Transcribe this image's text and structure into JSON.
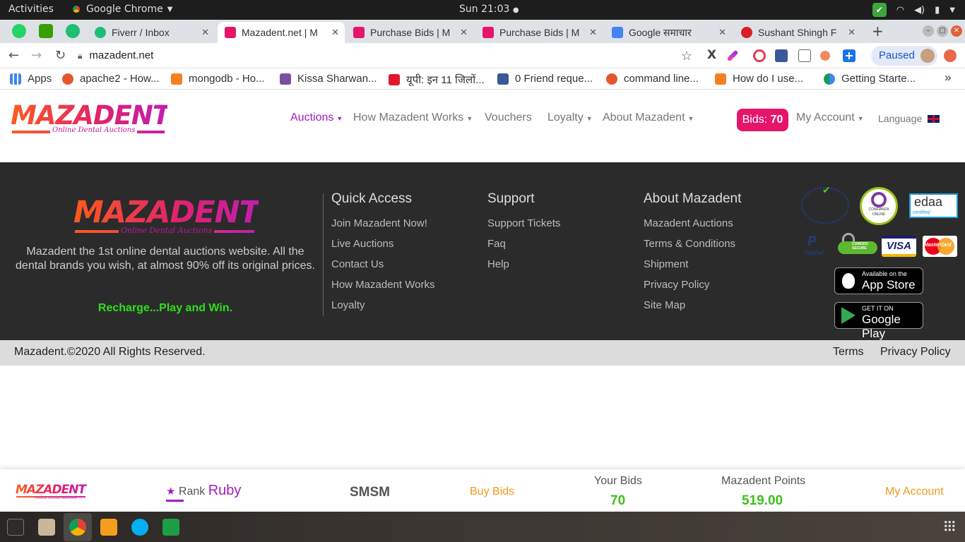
{
  "os": {
    "activities": "Activities",
    "app_name": "Google Chrome",
    "clock": "Sun 21:03"
  },
  "browser": {
    "tabs": [
      {
        "title": "Fiverr / Inbox"
      },
      {
        "title": "Mazadent.net | M"
      },
      {
        "title": "Purchase Bids | M"
      },
      {
        "title": "Purchase Bids | M"
      },
      {
        "title": "Google समाचार"
      },
      {
        "title": "Sushant Shingh F"
      }
    ],
    "url": "mazadent.net",
    "profile_status": "Paused",
    "bookmarks": [
      {
        "label": "Apps"
      },
      {
        "label": "apache2 - How..."
      },
      {
        "label": "mongodb - Ho..."
      },
      {
        "label": "Kissa Sharwan..."
      },
      {
        "label": "यूपी: इन 11 जिलों..."
      },
      {
        "label": "0 Friend reque..."
      },
      {
        "label": "command line..."
      },
      {
        "label": "How do I use..."
      },
      {
        "label": "Getting Starte..."
      }
    ],
    "bookmarks_more": "»"
  },
  "site": {
    "logo_text": "MAZADENT",
    "logo_tagline": "Online Dental Auctions",
    "nav": [
      {
        "label": "Auctions"
      },
      {
        "label": "How Mazadent Works"
      },
      {
        "label": "Vouchers"
      },
      {
        "label": "Loyalty"
      },
      {
        "label": "About Mazadent"
      }
    ],
    "bids_label": "Bids:",
    "bids_value": "70",
    "my_account": "My Account",
    "language": "Language",
    "colors": {
      "accent": "#e5156b",
      "nav_active": "#a21cc4",
      "green": "#3fbf1c",
      "orange": "#ef9a1a"
    }
  },
  "footer": {
    "description": "Mazadent the 1st online dental auctions website. All the dental brands you wish, at almost 90% off its original prices.",
    "slogan": "Recharge...Play and Win.",
    "quick_access": {
      "title": "Quick Access",
      "links": [
        "Join Mazadent Now!",
        "Live Auctions",
        "Contact Us",
        "How Mazadent Works",
        "Loyalty"
      ]
    },
    "support": {
      "title": "Support",
      "links": [
        "Support Tickets",
        "Faq",
        "Help"
      ]
    },
    "about": {
      "title": "About Mazadent",
      "links": [
        "Mazadent Auctions",
        "Terms & Conditions",
        "Shipment",
        "Privacy Policy",
        "Site Map"
      ]
    },
    "badges": {
      "confianza": "CONFIANZA",
      "confianza_sub": "ONLINE",
      "edaa": "edaa",
      "edaa_sub": "certified",
      "paypal": "PayPal",
      "comodo": "COMODO SECURE",
      "visa": "VISA",
      "mastercard": "MasterCard"
    },
    "appstore_small": "Available on the",
    "appstore_big": "App Store",
    "googleplay_small": "GET IT ON",
    "googleplay_big": "Google Play",
    "copyright": "Mazadent.©2020 All Rights Reserved.",
    "terms": "Terms",
    "privacy": "Privacy Policy"
  },
  "bottombar": {
    "rank_label": "Rank",
    "rank_value": "Ruby",
    "username": "SMSM",
    "buy_bids": "Buy Bids",
    "your_bids_label": "Your Bids",
    "your_bids_value": "70",
    "points_label": "Mazadent Points",
    "points_value": "519.00",
    "my_account": "My Account"
  }
}
